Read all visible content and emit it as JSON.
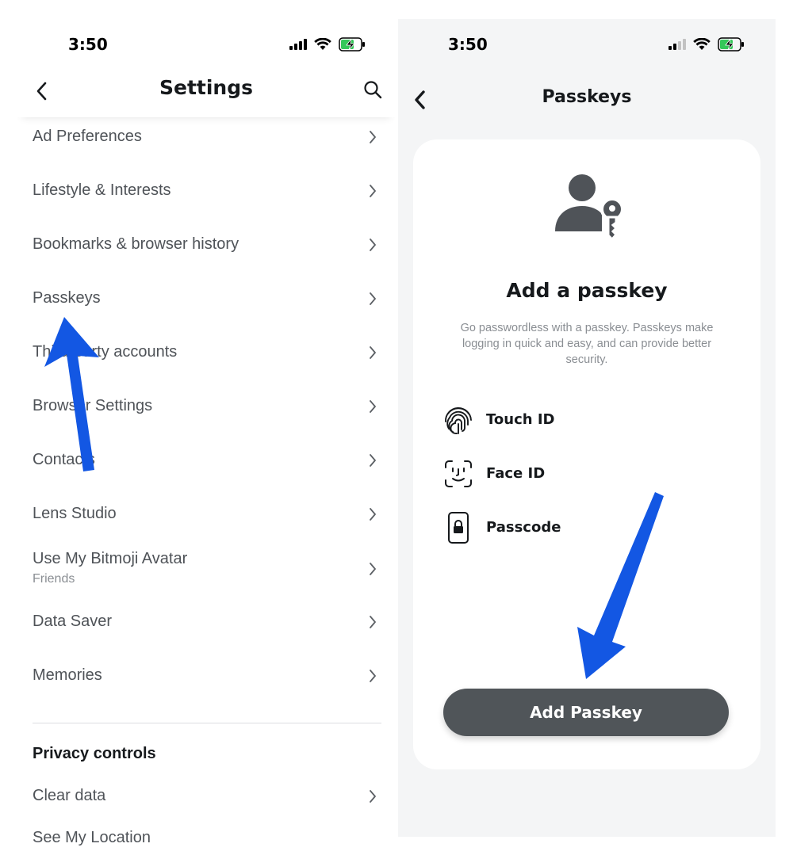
{
  "status_bar": {
    "time": "3:50"
  },
  "settings": {
    "title": "Settings",
    "items": [
      {
        "label": "Ad Preferences"
      },
      {
        "label": "Lifestyle & Interests"
      },
      {
        "label": "Bookmarks & browser history"
      },
      {
        "label": "Passkeys"
      },
      {
        "label": "Third-party accounts"
      },
      {
        "label": "Browser Settings"
      },
      {
        "label": "Contacts"
      },
      {
        "label": "Lens Studio"
      },
      {
        "label": "Use My Bitmoji Avatar",
        "sublabel": "Friends"
      },
      {
        "label": "Data Saver"
      },
      {
        "label": "Memories"
      }
    ],
    "privacy_section_title": "Privacy controls",
    "privacy_items": [
      {
        "label": "Clear data"
      },
      {
        "label": "See My Location"
      }
    ]
  },
  "passkeys": {
    "title": "Passkeys",
    "heading": "Add a passkey",
    "description": "Go passwordless with a passkey. Passkeys make logging in quick and easy, and can provide better security.",
    "methods": [
      {
        "label": "Touch ID",
        "icon": "fingerprint-icon"
      },
      {
        "label": "Face ID",
        "icon": "face-id-icon"
      },
      {
        "label": "Passcode",
        "icon": "passcode-phone-icon"
      }
    ],
    "add_button_label": "Add Passkey"
  },
  "colors": {
    "annotation_arrow": "#1357e3",
    "button_bg": "#505559",
    "right_panel_bg": "#f4f5f6"
  }
}
